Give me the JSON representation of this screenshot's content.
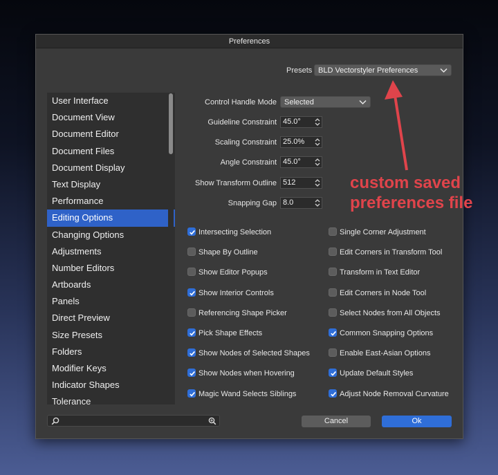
{
  "window": {
    "title": "Preferences"
  },
  "presets": {
    "label": "Presets",
    "value": "BLD Vectorstyler Preferences"
  },
  "sidebar": {
    "items": [
      {
        "label": "User Interface"
      },
      {
        "label": "Document View"
      },
      {
        "label": "Document Editor"
      },
      {
        "label": "Document Files"
      },
      {
        "label": "Document Display"
      },
      {
        "label": "Text Display"
      },
      {
        "label": "Performance"
      },
      {
        "label": "Editing Options",
        "selected": true
      },
      {
        "label": "Changing Options"
      },
      {
        "label": "Adjustments"
      },
      {
        "label": "Number Editors"
      },
      {
        "label": "Artboards"
      },
      {
        "label": "Panels"
      },
      {
        "label": "Direct Preview"
      },
      {
        "label": "Size Presets"
      },
      {
        "label": "Folders"
      },
      {
        "label": "Modifier Keys"
      },
      {
        "label": "Indicator Shapes"
      },
      {
        "label": "Tolerance"
      }
    ]
  },
  "fields": {
    "control_handle_mode": {
      "label": "Control Handle Mode",
      "value": "Selected"
    },
    "guideline_constraint": {
      "label": "Guideline Constraint",
      "value": "45.0°"
    },
    "scaling_constraint": {
      "label": "Scaling Constraint",
      "value": "25.0%"
    },
    "angle_constraint": {
      "label": "Angle Constraint",
      "value": "45.0°"
    },
    "show_transform_outline": {
      "label": "Show Transform Outline",
      "value": "512"
    },
    "snapping_gap": {
      "label": "Snapping Gap",
      "value": "8.0"
    }
  },
  "checkboxes_left": [
    {
      "label": "Intersecting Selection",
      "checked": true
    },
    {
      "label": "Shape By Outline",
      "checked": false
    },
    {
      "label": "Show Editor Popups",
      "checked": false
    },
    {
      "label": "Show Interior Controls",
      "checked": true
    },
    {
      "label": "Referencing Shape Picker",
      "checked": false
    },
    {
      "label": "Pick Shape Effects",
      "checked": true
    },
    {
      "label": "Show Nodes of Selected Shapes",
      "checked": true
    },
    {
      "label": "Show Nodes when Hovering",
      "checked": true
    },
    {
      "label": "Magic Wand Selects Siblings",
      "checked": true
    }
  ],
  "checkboxes_right": [
    {
      "label": "Single Corner Adjustment",
      "checked": false
    },
    {
      "label": "Edit Corners in Transform Tool",
      "checked": false
    },
    {
      "label": "Transform in Text Editor",
      "checked": false
    },
    {
      "label": "Edit Corners in Node Tool",
      "checked": false
    },
    {
      "label": "Select Nodes from All Objects",
      "checked": false
    },
    {
      "label": "Common Snapping Options",
      "checked": true
    },
    {
      "label": "Enable East-Asian Options",
      "checked": false
    },
    {
      "label": "Update Default Styles",
      "checked": true
    },
    {
      "label": "Adjust Node Removal Curvature",
      "checked": true
    }
  ],
  "search": {
    "placeholder": "",
    "value": ""
  },
  "buttons": {
    "cancel": "Cancel",
    "ok": "Ok"
  },
  "annotation": {
    "line1": "custom saved",
    "line2": "preferences file"
  },
  "colors": {
    "accent": "#2f6ed8",
    "selection": "#2f62c8",
    "annotation": "#e0444b"
  },
  "icons": {
    "search": "magnifier-icon",
    "zoom": "zoom-icon",
    "dropdown": "chevron-down-icon",
    "stepper": "stepper-arrows-icon"
  }
}
